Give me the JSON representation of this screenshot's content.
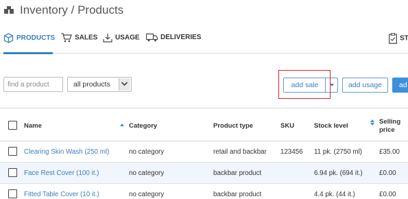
{
  "header": {
    "title": "Inventory / Products",
    "logo_icon": "boxes-icon"
  },
  "tabs": [
    {
      "label": "PRODUCTS",
      "icon": "cube-icon",
      "active": true
    },
    {
      "label": "SALES",
      "icon": "cart-icon",
      "active": false
    },
    {
      "label": "USAGE",
      "icon": "download-icon",
      "active": false
    },
    {
      "label": "DELIVERIES",
      "icon": "truck-icon",
      "active": false
    },
    {
      "label": "ST",
      "icon": "clipboard-icon",
      "active": false
    }
  ],
  "filters": {
    "search_placeholder": "find a product",
    "category_select": "all products"
  },
  "actions": {
    "add_sale": "add sale",
    "add_usage": "add usage",
    "add": "ad"
  },
  "table": {
    "columns": [
      "Name",
      "Category",
      "Product type",
      "SKU",
      "Stock level",
      "Selling price"
    ],
    "rows": [
      {
        "name": "Clearing Skin Wash (250 ml)",
        "category": "no category",
        "type": "retail and backbar",
        "sku": "123456",
        "stock": "11 pk. (2750 ml)",
        "price": "£35.00"
      },
      {
        "name": "Face Rest Cover (100 it.)",
        "category": "no category",
        "type": "backbar product",
        "sku": "",
        "stock": "6.94 pk. (694 it.)",
        "price": "£0.00"
      },
      {
        "name": "Fitted Table Cover (10 it.)",
        "category": "no category",
        "type": "backbar product",
        "sku": "",
        "stock": "4.4 pk. (44 it.)",
        "price": "£0.00"
      }
    ]
  },
  "colors": {
    "accent": "#3a7fbf",
    "highlight": "#e02020",
    "row_alt": "#f0f6fc"
  }
}
